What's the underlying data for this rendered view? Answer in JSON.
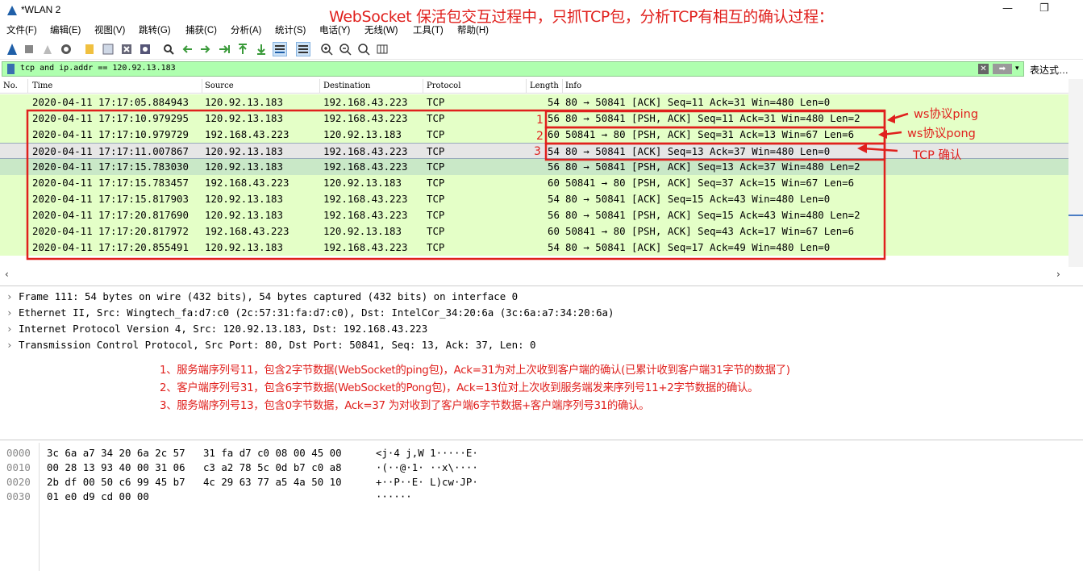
{
  "window": {
    "title": "*WLAN 2",
    "overlay_title": "WebSocket 保活包交互过程中，只抓TCP包，分析TCP有相互的确认过程：",
    "minimize": "—",
    "restore": "❐"
  },
  "menu": [
    "文件(F)",
    "编辑(E)",
    "视图(V)",
    "跳转(G)",
    "捕获(C)",
    "分析(A)",
    "统计(S)",
    "电话(Y)",
    "无线(W)",
    "工具(T)",
    "帮助(H)"
  ],
  "filter": {
    "value": "tcp and ip.addr == 120.92.13.183",
    "expression_label": "表达式…"
  },
  "columns": [
    "No.",
    "Time",
    "Source",
    "Destination",
    "Protocol",
    "Length",
    "Info"
  ],
  "packets": [
    {
      "time": "2020-04-11 17:17:05.884943",
      "src": "120.92.13.183",
      "dst": "192.168.43.223",
      "proto": "TCP",
      "len": "54",
      "info": "80 → 50841 [ACK] Seq=11 Ack=31 Win=480 Len=0"
    },
    {
      "time": "2020-04-11 17:17:10.979295",
      "src": "120.92.13.183",
      "dst": "192.168.43.223",
      "proto": "TCP",
      "len": "56",
      "info": "80 → 50841 [PSH, ACK] Seq=11 Ack=31 Win=480 Len=2"
    },
    {
      "time": "2020-04-11 17:17:10.979729",
      "src": "192.168.43.223",
      "dst": "120.92.13.183",
      "proto": "TCP",
      "len": "60",
      "info": "50841 → 80 [PSH, ACK] Seq=31 Ack=13 Win=67 Len=6"
    },
    {
      "time": "2020-04-11 17:17:11.007867",
      "src": "120.92.13.183",
      "dst": "192.168.43.223",
      "proto": "TCP",
      "len": "54",
      "info": "80 → 50841 [ACK] Seq=13 Ack=37 Win=480 Len=0"
    },
    {
      "time": "2020-04-11 17:17:15.783030",
      "src": "120.92.13.183",
      "dst": "192.168.43.223",
      "proto": "TCP",
      "len": "56",
      "info": "80 → 50841 [PSH, ACK] Seq=13 Ack=37 Win=480 Len=2"
    },
    {
      "time": "2020-04-11 17:17:15.783457",
      "src": "192.168.43.223",
      "dst": "120.92.13.183",
      "proto": "TCP",
      "len": "60",
      "info": "50841 → 80 [PSH, ACK] Seq=37 Ack=15 Win=67 Len=6"
    },
    {
      "time": "2020-04-11 17:17:15.817903",
      "src": "120.92.13.183",
      "dst": "192.168.43.223",
      "proto": "TCP",
      "len": "54",
      "info": "80 → 50841 [ACK] Seq=15 Ack=43 Win=480 Len=0"
    },
    {
      "time": "2020-04-11 17:17:20.817690",
      "src": "120.92.13.183",
      "dst": "192.168.43.223",
      "proto": "TCP",
      "len": "56",
      "info": "80 → 50841 [PSH, ACK] Seq=15 Ack=43 Win=480 Len=2"
    },
    {
      "time": "2020-04-11 17:17:20.817972",
      "src": "192.168.43.223",
      "dst": "120.92.13.183",
      "proto": "TCP",
      "len": "60",
      "info": "50841 → 80 [PSH, ACK] Seq=43 Ack=17 Win=67 Len=6"
    },
    {
      "time": "2020-04-11 17:17:20.855491",
      "src": "120.92.13.183",
      "dst": "192.168.43.223",
      "proto": "TCP",
      "len": "54",
      "info": "80 → 50841 [ACK] Seq=17 Ack=49 Win=480 Len=0"
    }
  ],
  "annotations": {
    "n1": "1",
    "n2": "2",
    "n3": "3",
    "ping": "ws协议ping",
    "pong": "ws协议pong",
    "ack": "TCP 确认"
  },
  "details": [
    "Frame 111: 54 bytes on wire (432 bits), 54 bytes captured (432 bits) on interface 0",
    "Ethernet II, Src: Wingtech_fa:d7:c0 (2c:57:31:fa:d7:c0), Dst: IntelCor_34:20:6a (3c:6a:a7:34:20:6a)",
    "Internet Protocol Version 4, Src: 120.92.13.183, Dst: 192.168.43.223",
    "Transmission Control Protocol, Src Port: 80, Dst Port: 50841, Seq: 13, Ack: 37, Len: 0"
  ],
  "notes": [
    "1、服务端序列号11，包含2字节数据(WebSocket的ping包)，Ack=31为对上次收到客户端的确认(已累计收到客户端31字节的数据了)",
    "2、客户端序列号31，包含6字节数据(WebSocket的Pong包)，Ack=13位对上次收到服务端发来序列号11+2字节数据的确认。",
    "3、服务端序列号13，包含0字节数据，Ack=37 为对收到了客户端6字节数据+客户端序列号31的确认。"
  ],
  "bytes": [
    {
      "off": "0000",
      "hex": "3c 6a a7 34 20 6a 2c 57   31 fa d7 c0 08 00 45 00",
      "ascii": "<j·4 j,W 1·····E·"
    },
    {
      "off": "0010",
      "hex": "00 28 13 93 40 00 31 06   c3 a2 78 5c 0d b7 c0 a8",
      "ascii": "·(··@·1· ··x\\····"
    },
    {
      "off": "0020",
      "hex": "2b df 00 50 c6 99 45 b7   4c 29 63 77 a5 4a 50 10",
      "ascii": "+··P··E· L)cw·JP·"
    },
    {
      "off": "0030",
      "hex": "01 e0 d9 cd 00 00",
      "ascii": "······"
    }
  ],
  "colors": {
    "accent_red": "#e0201d",
    "tcp_row": "#e4ffc7",
    "filter_ok": "#afffaf"
  }
}
